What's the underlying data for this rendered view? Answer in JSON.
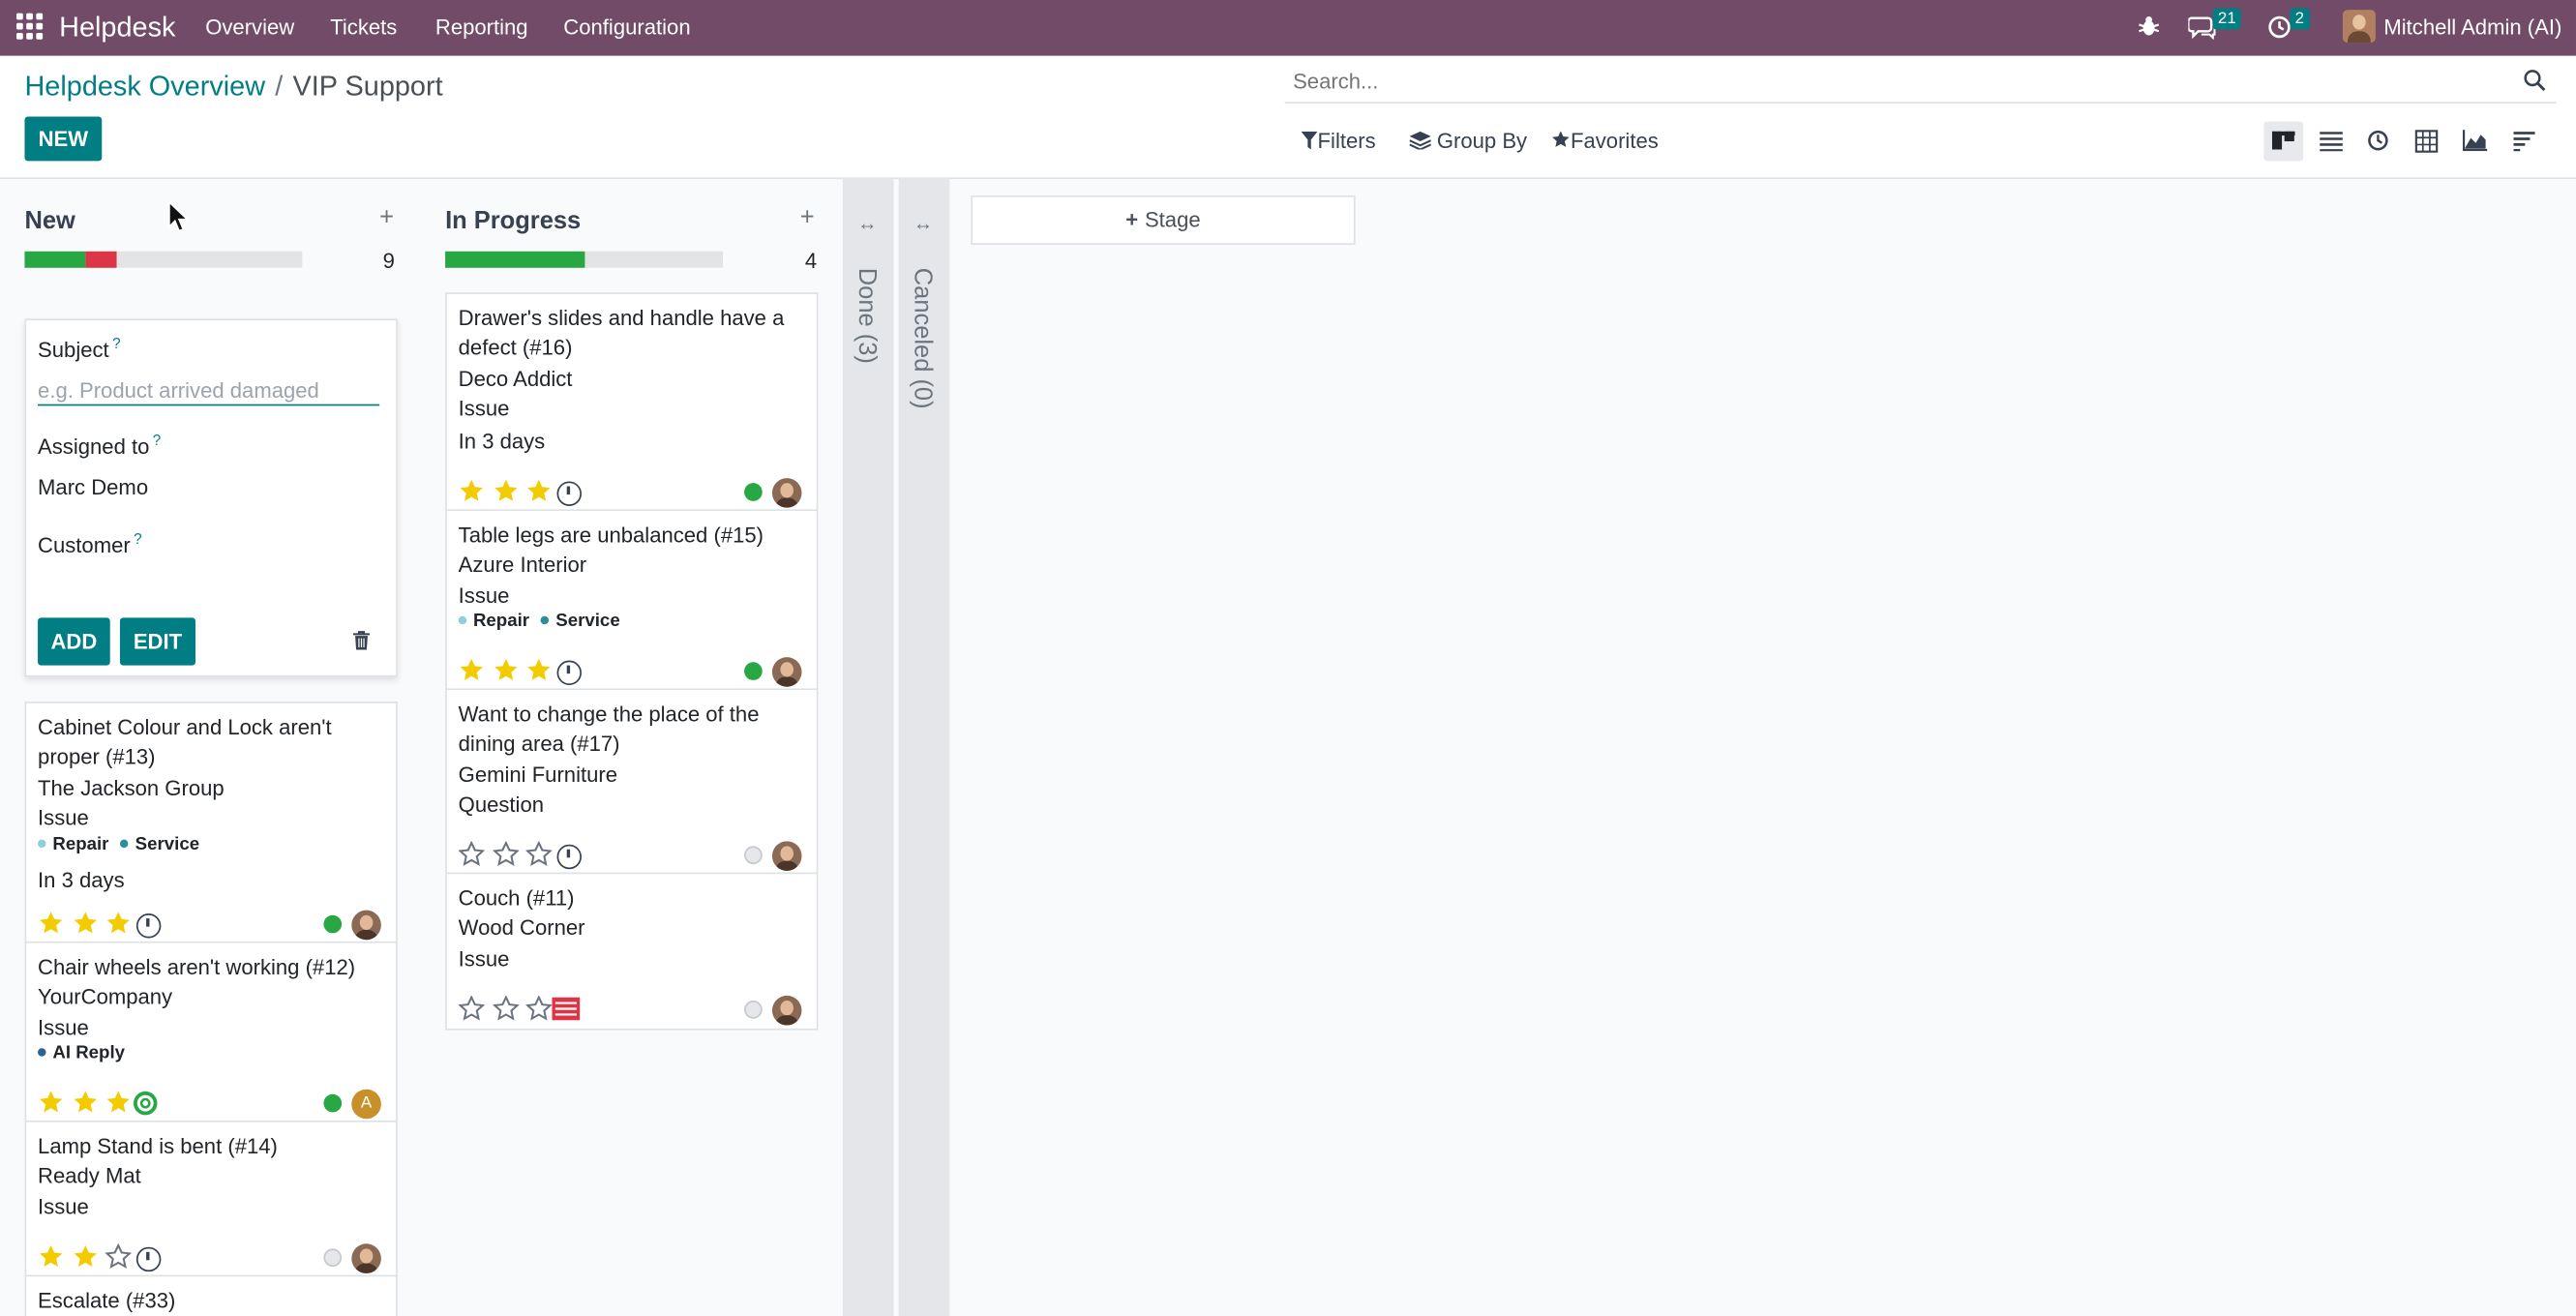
{
  "navbar": {
    "brand": "Helpdesk",
    "menu": [
      "Overview",
      "Tickets",
      "Reporting",
      "Configuration"
    ],
    "chat_count": "21",
    "activity_count": "2",
    "user": "Mitchell Admin (AI)"
  },
  "breadcrumb": {
    "parent": "Helpdesk Overview",
    "current": "VIP Support"
  },
  "new_button": "NEW",
  "search": {
    "placeholder": "Search..."
  },
  "filters": {
    "filters": "Filters",
    "group_by": "Group By",
    "favorites": "Favorites"
  },
  "views": [
    "kanban-view-icon",
    "list-view-icon",
    "activity-view-icon",
    "pivot-view-icon",
    "graph-view-icon",
    "cohort-view-icon"
  ],
  "columns": {
    "new": {
      "title": "New",
      "count": "9",
      "progress": {
        "green": 0.22,
        "red": 0.11
      }
    },
    "in_progress": {
      "title": "In Progress",
      "count": "4",
      "progress": {
        "green": 0.5,
        "red": 0
      }
    },
    "done": {
      "title": "Done (3)"
    },
    "canceled": {
      "title": "Canceled (0)"
    }
  },
  "quick_create": {
    "subject_label": "Subject",
    "subject_placeholder": "e.g. Product arrived damaged",
    "assigned_label": "Assigned to",
    "assigned_value": "Marc Demo",
    "customer_label": "Customer",
    "help_mark": "?",
    "add": "ADD",
    "edit": "EDIT"
  },
  "new_cards": [
    {
      "title1": "Cabinet Colour and Lock aren't",
      "title2": "proper (#13)",
      "customer": "The Jackson Group",
      "type": "Issue",
      "tags": [
        "Repair",
        "Service"
      ],
      "deadline": "In 3 days",
      "stars": 3,
      "state": "green"
    },
    {
      "title1": "Chair wheels aren't working (#12)",
      "customer": "YourCompany",
      "type": "Issue",
      "tags": [
        "AI Reply"
      ],
      "stars": 3,
      "state": "green",
      "avatar_letter": "A"
    },
    {
      "title1": "Lamp Stand is bent (#14)",
      "customer": "Ready Mat",
      "type": "Issue",
      "stars": 2,
      "state": "grey"
    },
    {
      "title1": "Escalate (#33)"
    }
  ],
  "progress_cards": [
    {
      "title1": "Drawer's slides and handle have a",
      "title2": "defect (#16)",
      "customer": "Deco Addict",
      "type": "Issue",
      "deadline": "In 3 days",
      "stars": 3,
      "state": "green"
    },
    {
      "title1": "Table legs are unbalanced (#15)",
      "customer": "Azure Interior",
      "type": "Issue",
      "tags": [
        "Repair",
        "Service"
      ],
      "stars": 3,
      "state": "green"
    },
    {
      "title1": "Want to change the place of the",
      "title2": "dining area (#17)",
      "customer": "Gemini Furniture",
      "type": "Question",
      "stars": 0,
      "state": "grey"
    },
    {
      "title1": "Couch (#11)",
      "customer": "Wood Corner",
      "type": "Issue",
      "stars": 0,
      "state": "grey"
    }
  ],
  "stage_button": "Stage",
  "colors": {
    "navbar": "#714b67",
    "primary": "#017e84",
    "star": "#f3cc00",
    "green": "#28a745",
    "red": "#dc3545"
  }
}
